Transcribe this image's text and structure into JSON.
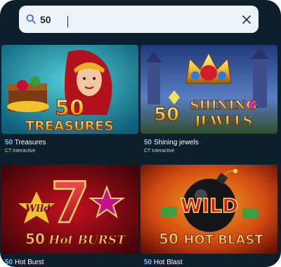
{
  "search": {
    "value": "50",
    "placeholder": ""
  },
  "games": [
    {
      "highlight": "50",
      "name": " Treasures",
      "provider": "CT Interactive",
      "art_number": "50",
      "art_text": "TREASURES"
    },
    {
      "highlight": "50",
      "name": " Shining jewels",
      "provider": "CT Interactive",
      "art_number": "50",
      "art_text_1": "SHINING",
      "art_text_2": "JEWELS"
    },
    {
      "highlight": "50",
      "name": " Hot Burst",
      "art_number": "50",
      "art_text": "Hot BURST",
      "art_wild": "Wild",
      "art_seven": "7"
    },
    {
      "highlight": "50",
      "name": " Hot Blast",
      "art_number": "50",
      "art_text": "HOT BLAST",
      "art_wild": "WILD"
    }
  ],
  "colors": {
    "background": "#0d1f2b",
    "highlight": "#6fc3ff",
    "search_bg": "#eef3f8"
  }
}
